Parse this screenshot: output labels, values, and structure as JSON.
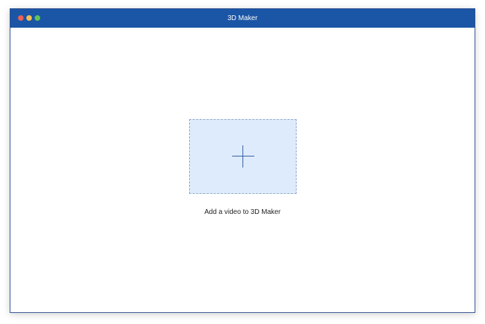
{
  "window": {
    "title": "3D Maker",
    "accent_color": "#1b56a6"
  },
  "traffic_lights": {
    "close_color": "#ee5f57",
    "minimize_color": "#f5bd4f",
    "maximize_color": "#5fc453"
  },
  "dropzone": {
    "icon": "plus-icon",
    "caption": "Add a video to 3D Maker",
    "fill_color": "#deebfd"
  }
}
